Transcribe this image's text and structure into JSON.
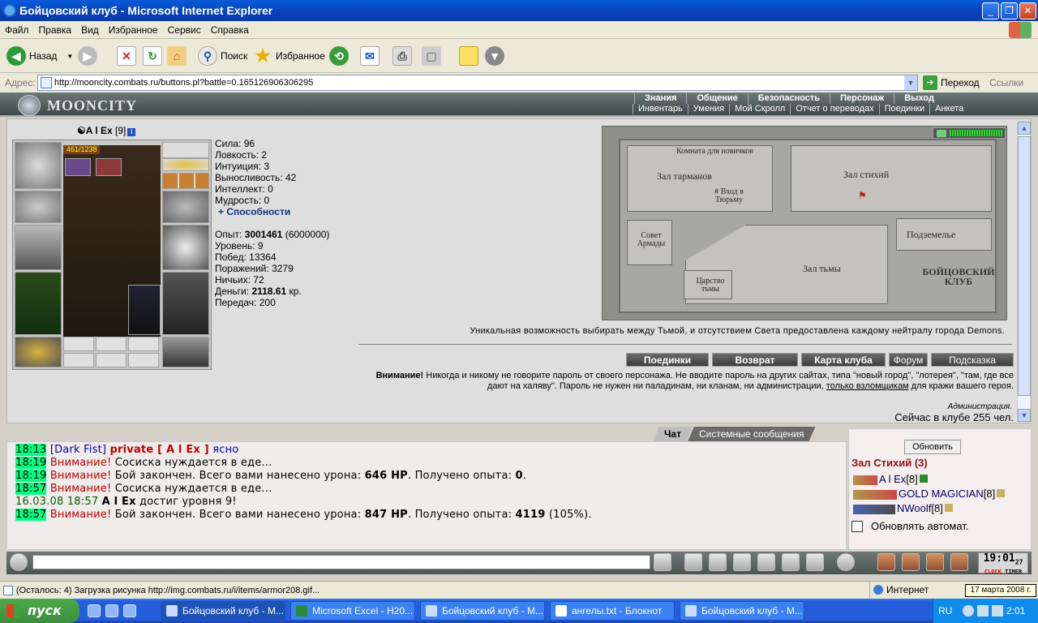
{
  "window": {
    "title": "Бойцовский клуб - Microsoft Internet Explorer",
    "min": "_",
    "max": "❐",
    "close": "✕"
  },
  "menu": [
    "Файл",
    "Правка",
    "Вид",
    "Избранное",
    "Сервис",
    "Справка"
  ],
  "toolbar": {
    "back": "Назад",
    "search": "Поиск",
    "favorites": "Избранное"
  },
  "address": {
    "label": "Адрес:",
    "url": "http://mooncity.combats.ru/buttons.pl?battle=0.165126906306295",
    "go": "Переход",
    "links": "Ссылки"
  },
  "game": {
    "logo": "MOONCITY",
    "topnav": [
      "Знания",
      "Общение",
      "Безопасность",
      "Персонаж",
      "Выход"
    ],
    "subnav": [
      "Инвентарь",
      "Умения",
      "Мой Скролл",
      "Отчет о переводах",
      "Поединки",
      "Анкета"
    ]
  },
  "character": {
    "name": "A l Ex",
    "level": "[9]",
    "hp": "461/1238",
    "hp_fraction": 0.372,
    "stats": [
      {
        "label": "Сила:",
        "value": "96"
      },
      {
        "label": "Ловкость:",
        "value": "2"
      },
      {
        "label": "Интуиция:",
        "value": "3"
      },
      {
        "label": "Выносливость:",
        "value": "42"
      },
      {
        "label": "Интеллект:",
        "value": "0"
      },
      {
        "label": "Мудрость:",
        "value": "0"
      }
    ],
    "abilities": "+ Способности",
    "exp_label": "Опыт:",
    "exp_value": "3001461",
    "exp_next": "(6000000)",
    "level_label": "Уровень:",
    "level_value": "9",
    "wins_label": "Побед:",
    "wins_value": "13364",
    "losses_label": "Поражений:",
    "losses_value": "3279",
    "draws_label": "Ничьих:",
    "draws_value": "72",
    "money_label": "Деньги:",
    "money_value": "2118.61",
    "money_unit": "кр.",
    "transfers_label": "Передач:",
    "transfers_value": "200"
  },
  "map": {
    "rooms": {
      "newbie": "Комната для новичков",
      "tarmany": "Зал тарманов",
      "prison": "# Вход в Тюрьму",
      "stihii": "Зал стихий",
      "council": "Совет Армады",
      "dungeon": "Подземелье",
      "darkness": "Зал тьмы",
      "kingdom": "Царство тьмы",
      "club": "БОЙЦОВСКИЙ КЛУБ"
    },
    "caption": "Уникальная возможность выбирать между Тьмой, и отсутствием Света предоставлена каждому нейтралу города Demons."
  },
  "buttons": [
    "Поединки",
    "Возврат",
    "Карта клуба",
    "Форум",
    "Подсказка"
  ],
  "warning": {
    "bold": "Внимание!",
    "text": " Никогда и никому не говорите пароль от своего персонажа. Не вводите пароль на других сайтах, типа \"новый город\", \"лотерея\", \"там, где все дают на халяву\". Пароль не нужен ни паладинам, ни кланам, ни администрации, ",
    "link": "только взломщикам",
    "tail": " для кражи вашего героя.",
    "admin": "Администрация."
  },
  "online": "Сейчас в клубе 255 чел.",
  "chat": {
    "tabs": [
      "Чат",
      "Системные сообщения"
    ],
    "lines": [
      {
        "time": "18:13",
        "a": "[Dark Fist]",
        "b": "private [ A l Ex ]",
        "c": "ясно"
      },
      {
        "time": "18:19",
        "warn": "Внимание!",
        "text": "Сосиска нуждается в еде..."
      },
      {
        "time": "18:19",
        "warn": "Внимание!",
        "text": "Бой закончен. Всего вами нанесено урона:",
        "dmg": "646 HP",
        "text2": ". Получено опыта:",
        "exp": "0",
        "text3": "."
      },
      {
        "time": "18:57",
        "warn": "Внимание!",
        "text": "Сосиска нуждается в еде..."
      },
      {
        "time": "16.03.08 18:57",
        "who": "A l Ex",
        "text": "достиг уровня 9!"
      },
      {
        "time": "18:57",
        "warn": "Внимание!",
        "text": "Бой закончен. Всего вами нанесено урона:",
        "dmg": "847 HP",
        "text2": ". Получено опыта:",
        "exp": "4119",
        "text3": "(105%)."
      }
    ]
  },
  "side": {
    "refresh": "Обновить",
    "room": "Зал Стихий (3)",
    "players": [
      {
        "name": "A l Ex",
        "level": "[8]"
      },
      {
        "name": "GOLD MAGICIAN",
        "level": "[8]"
      },
      {
        "name": "NWoolf",
        "level": "[8]"
      }
    ],
    "auto": "Обновлять автомат."
  },
  "clock": {
    "time": "19:01",
    "sub": "27",
    "label1": "CLOCK",
    "label2": "TIMER"
  },
  "status": {
    "text": "(Осталось: 4) Загрузка рисунка http://img.combats.ru/i/items/armor208.gif...",
    "zone": "Интернет",
    "date_tip": "17 марта 2008 г."
  },
  "taskbar": {
    "start": "пуск",
    "tasks": [
      "Бойцовский клуб - M...",
      "Microsoft Excel - H20...",
      "Бойцовский клуб - M...",
      "ангелы.txt - Блокнот",
      "Бойцовский клуб - M..."
    ],
    "lang": "RU",
    "time": "2:01"
  },
  "colors": {
    "accent": "#245edb",
    "chat_time": "#00ff7f",
    "warn": "#c00000"
  }
}
